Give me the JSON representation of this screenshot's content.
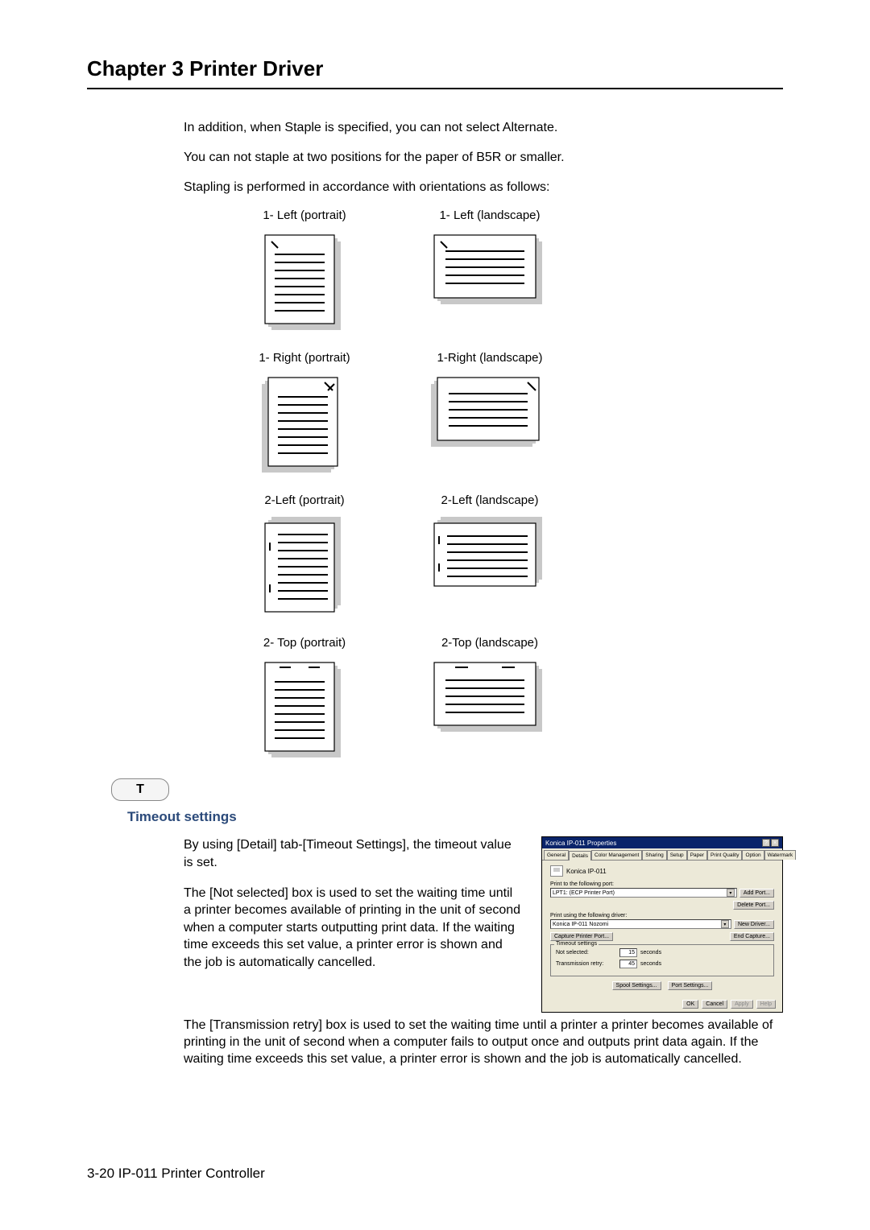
{
  "chapter_title": "Chapter 3   Printer Driver",
  "intro": {
    "p1": "In addition, when Staple is specified, you can not select Alternate.",
    "p2": "You can not staple at two positions for the paper of B5R or smaller.",
    "p3": "Stapling is performed in accordance with orientations as follows:"
  },
  "staple_labels": {
    "r1c1": "1- Left (portrait)",
    "r1c2": "1- Left (landscape)",
    "r2c1": "1- Right (portrait)",
    "r2c2": "1-Right (landscape)",
    "r3c1": "2-Left (portrait)",
    "r3c2": "2-Left (landscape)",
    "r4c1": "2- Top (portrait)",
    "r4c2": "2-Top (landscape)"
  },
  "t_badge": "T",
  "section_heading": "Timeout settings",
  "timeout": {
    "p1": "By using [Detail] tab-[Timeout Settings], the timeout value is set.",
    "p2": "The [Not selected] box is used to set the waiting time until a printer becomes available of printing in the unit of second when a computer starts outputting print data. If the waiting time exceeds this set value, a printer error is shown and the job is automatically cancelled.",
    "p3": "The [Transmission retry] box is used to set the waiting time until a printer a printer becomes available of printing in the unit of second when a computer fails to output once and outputs print data again. If the waiting time exceeds this set value, a printer error is shown and the job is automatically cancelled."
  },
  "dialog": {
    "title": "Konica IP-011 Properties",
    "tabs": [
      "General",
      "Details",
      "Color Management",
      "Sharing",
      "Setup",
      "Paper",
      "Print Quality",
      "Option",
      "Watermark"
    ],
    "printer_name": "Konica IP-011",
    "port_label": "Print to the following port:",
    "port_value": "LPT1: (ECP Printer Port)",
    "add_port": "Add Port...",
    "delete_port": "Delete Port...",
    "driver_label": "Print using the following driver:",
    "driver_value": "Konica IP-011 Nozomi",
    "new_driver": "New Driver...",
    "capture_port": "Capture Printer Port...",
    "end_capture": "End Capture...",
    "timeout_legend": "Timeout settings",
    "not_selected_label": "Not selected:",
    "not_selected_value": "15",
    "trans_retry_label": "Transmission retry:",
    "trans_retry_value": "45",
    "seconds": "seconds",
    "spool": "Spool Settings...",
    "portset": "Port Settings...",
    "ok": "OK",
    "cancel": "Cancel",
    "apply": "Apply",
    "help": "Help"
  },
  "footer": "3-20  IP-011 Printer Controller"
}
